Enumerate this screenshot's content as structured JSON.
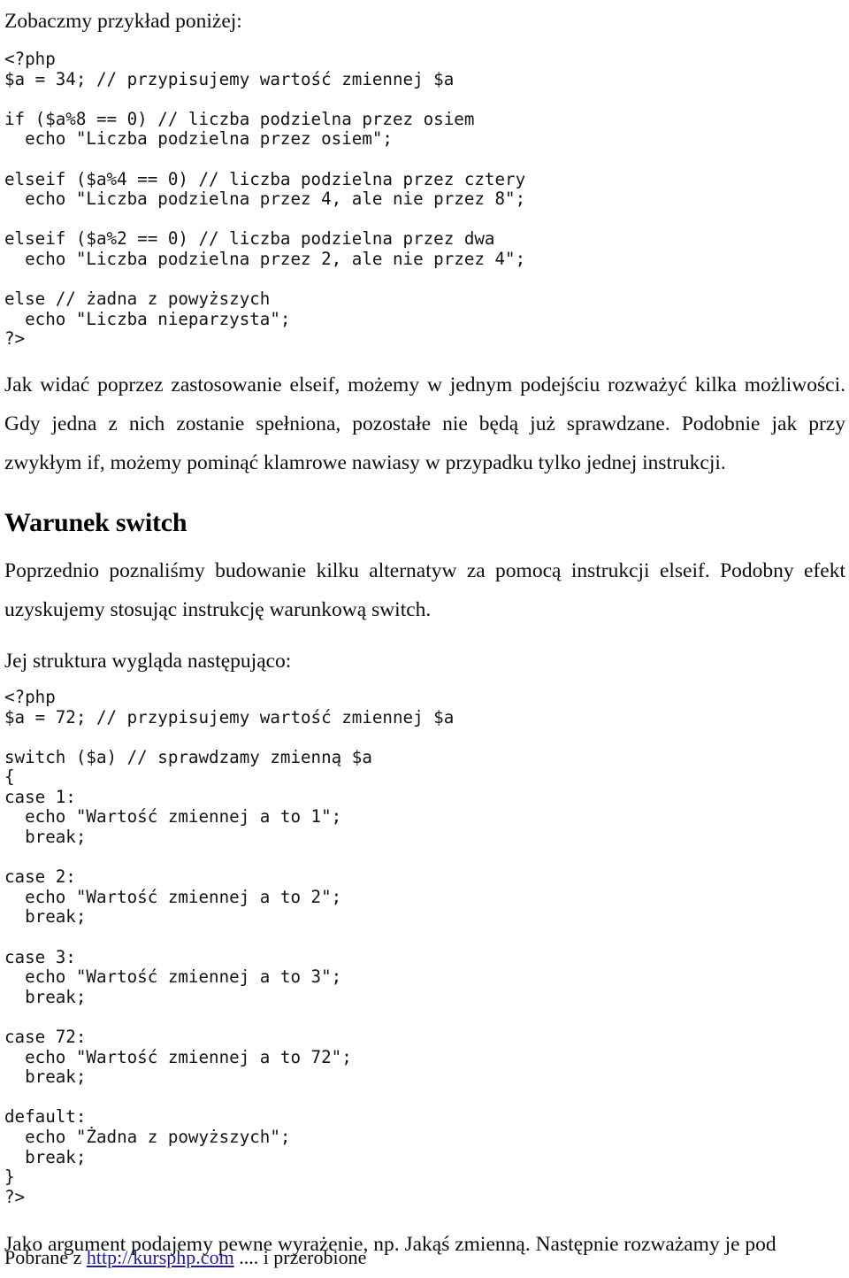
{
  "document": {
    "language": "pl",
    "background_color": "#ffffff",
    "text_color": "#0d0d0d",
    "link_color": "#1f1f8f"
  },
  "intro": {
    "text": "Zobaczmy przykład poniżej:"
  },
  "code_block_elseif": {
    "language": "php",
    "lines": [
      "<?php",
      "$a = 34; // przypisujemy wartość zmiennej $a",
      "",
      "if ($a%8 == 0) // liczba podzielna przez osiem",
      "  echo \"Liczba podzielna przez osiem\";",
      "",
      "elseif ($a%4 == 0) // liczba podzielna przez cztery",
      "  echo \"Liczba podzielna przez 4, ale nie przez 8\";",
      "",
      "elseif ($a%2 == 0) // liczba podzielna przez dwa",
      "  echo \"Liczba podzielna przez 2, ale nie przez 4\";",
      "",
      "else // żadna z powyższych",
      "  echo \"Liczba nieparzysta\";",
      "?>"
    ]
  },
  "paragraph_elseif_explanation": {
    "text": "Jak widać poprzez zastosowanie elseif, możemy w jednym podejściu rozważyć kilka możliwości. Gdy jedna z nich zostanie spełniona, pozostałe nie będą już sprawdzane. Podobnie jak przy zwykłym if, możemy pominąć klamrowe nawiasy w przypadku tylko jednej instrukcji."
  },
  "section_switch": {
    "heading": "Warunek switch",
    "paragraph": "Poprzednio poznaliśmy budowanie kilku alternatyw za pomocą instrukcji elseif. Podobny efekt uzyskujemy stosując instrukcję warunkową switch.",
    "structure_intro": "Jej struktura wygląda następująco:"
  },
  "code_block_switch": {
    "language": "php",
    "lines": [
      "<?php",
      "$a = 72; // przypisujemy wartość zmiennej $a",
      "",
      "switch ($a) // sprawdzamy zmienną $a",
      "{",
      "case 1:",
      "  echo \"Wartość zmiennej a to 1\";",
      "  break;",
      "",
      "case 2:",
      "  echo \"Wartość zmiennej a to 2\";",
      "  break;",
      "",
      "case 3:",
      "  echo \"Wartość zmiennej a to 3\";",
      "  break;",
      "",
      "case 72:",
      "  echo \"Wartość zmiennej a to 72\";",
      "  break;",
      "",
      "default:",
      "  echo \"Żadna z powyższych\";",
      "  break;",
      "}",
      "?>"
    ]
  },
  "paragraph_switch_argument": {
    "text": "Jako argument podajemy pewne wyrażenie, np. Jakąś zmienną. Następnie rozważamy je pod"
  },
  "footer": {
    "prefix": "Pobrane z ",
    "link_text": "http://kursphp.com",
    "suffix": " .... i przerobione"
  }
}
